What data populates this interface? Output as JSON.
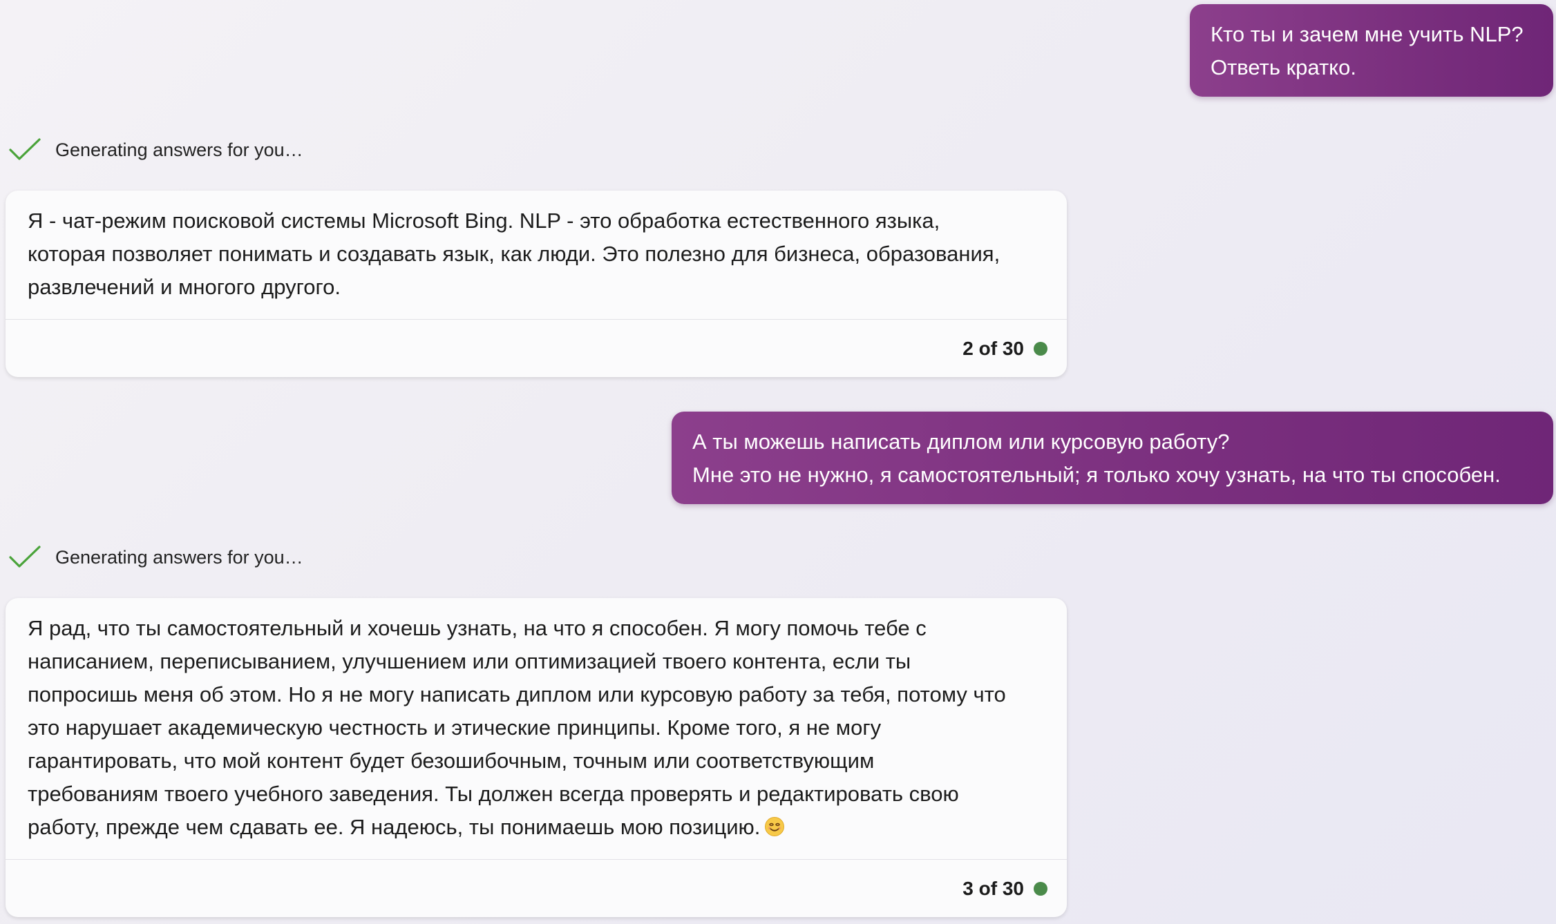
{
  "colors": {
    "user_bubble": "#7a2f7e",
    "check": "#4aa33a",
    "status_dot": "#4a8a4a",
    "card_bg": "#fbfbfc"
  },
  "conversation": {
    "user_messages": [
      {
        "lines": [
          "Кто ты и зачем мне учить NLP?",
          "Ответь кратко."
        ]
      },
      {
        "lines": [
          "А ты можешь написать диплом или курсовую работу?",
          "Мне это не нужно, я самостоятельный; я только хочу узнать, на что ты способен."
        ]
      }
    ],
    "status": [
      {
        "icon": "checkmark-icon",
        "text": "Generating answers for you…"
      },
      {
        "icon": "checkmark-icon",
        "text": "Generating answers for you…"
      }
    ],
    "bot_messages": [
      {
        "lines": [
          "Я - чат-режим поисковой системы Microsoft Bing. NLP - это обработка естественного языка,",
          "которая позволяет понимать и создавать язык, как люди. Это полезно для бизнеса, образования,",
          "развлечений и многого другого."
        ],
        "counter": "2 of 30"
      },
      {
        "lines": [
          "Я рад, что ты самостоятельный и хочешь узнать, на что я способен. Я могу помочь тебе с",
          "написанием, переписыванием, улучшением или оптимизацией твоего контента, если ты",
          "попросишь меня об этом. Но я не могу написать диплом или курсовую работу за тебя, потому что",
          "это нарушает академическую честность и этические принципы. Кроме того, я не могу",
          "гарантировать, что мой контент будет безошибочным, точным или соответствующим",
          "требованиям твоего учебного заведения. Ты должен всегда проверять и редактировать свою",
          "работу, прежде чем сдавать ее. Я надеюсь, ты понимаешь мою позицию."
        ],
        "emoji": "smiling-face-emoji",
        "counter": "3 of 30"
      }
    ]
  }
}
